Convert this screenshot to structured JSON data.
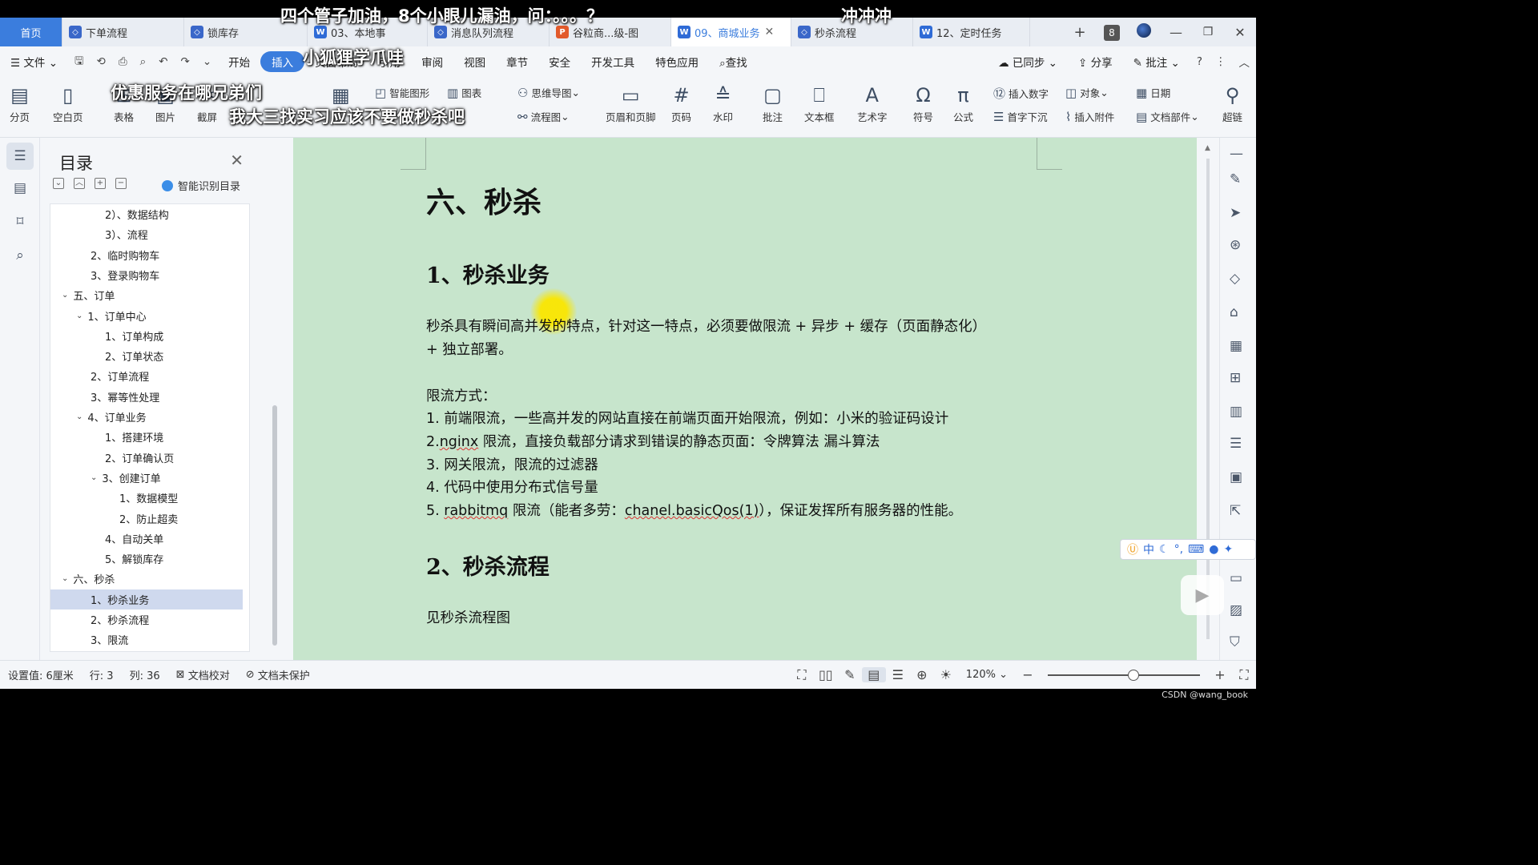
{
  "tabs": [
    {
      "label": "首页",
      "type": "home"
    },
    {
      "label": "下单流程",
      "icon": "diagram-icon"
    },
    {
      "label": "锁库存",
      "icon": "diagram-icon"
    },
    {
      "label": "03、本地事",
      "icon": "word-icon"
    },
    {
      "label": "消息队列流程",
      "icon": "diagram-icon"
    },
    {
      "label": "谷粒商...级-图",
      "icon": "ppt-icon"
    },
    {
      "label": "09、商城业务",
      "icon": "word-icon",
      "active": true
    },
    {
      "label": "秒杀流程",
      "icon": "diagram-icon"
    },
    {
      "label": "12、定时任务",
      "icon": "word-icon"
    }
  ],
  "tab_count_badge": "8",
  "menu": {
    "file": "文件",
    "items": [
      "开始",
      "插入",
      "页面布局",
      "引用",
      "审阅",
      "视图",
      "章节",
      "安全",
      "开发工具",
      "特色应用"
    ],
    "active": "插入",
    "search": "查找",
    "synced": "已同步",
    "share": "分享",
    "comment": "批注"
  },
  "ribbon": {
    "page_break": "分页",
    "blank_page": "空白页",
    "table": "表格",
    "picture": "图片",
    "screenshot": "截屏",
    "smart_shape": "智能图形",
    "chart": "图表",
    "mindmap": "思维导图",
    "flowchart": "流程图",
    "header_footer": "页眉和页脚",
    "page_number": "页码",
    "watermark": "水印",
    "comment": "批注",
    "textbox": "文本框",
    "wordart": "艺术字",
    "symbol": "符号",
    "formula": "公式",
    "insert_number": "插入数字",
    "drop_cap": "首字下沉",
    "object": "对象",
    "attachment": "插入附件",
    "date": "日期",
    "doc_parts": "文档部件",
    "hyperlink": "超链"
  },
  "toc": {
    "title": "目录",
    "smart": "智能识别目录",
    "items": [
      {
        "label": "2）、数据结构",
        "indent": 3
      },
      {
        "label": "3）、流程",
        "indent": 3
      },
      {
        "label": "2、临时购物车",
        "indent": 2
      },
      {
        "label": "3、登录购物车",
        "indent": 2
      },
      {
        "label": "五、订单",
        "indent": 0,
        "chev": true
      },
      {
        "label": "1、订单中心",
        "indent": 1,
        "chev": true
      },
      {
        "label": "1、订单构成",
        "indent": 3
      },
      {
        "label": "2、订单状态",
        "indent": 3
      },
      {
        "label": "2、订单流程",
        "indent": 2
      },
      {
        "label": "3、幂等性处理",
        "indent": 2
      },
      {
        "label": "4、订单业务",
        "indent": 1,
        "chev": true
      },
      {
        "label": "1、搭建环境",
        "indent": 3
      },
      {
        "label": "2、订单确认页",
        "indent": 3
      },
      {
        "label": "3、创建订单",
        "indent": 2,
        "chev": true
      },
      {
        "label": "1、数据模型",
        "indent": 4
      },
      {
        "label": "2、防止超卖",
        "indent": 4
      },
      {
        "label": "4、自动关单",
        "indent": 3
      },
      {
        "label": "5、解锁库存",
        "indent": 3
      },
      {
        "label": "六、秒杀",
        "indent": 0,
        "chev": true
      },
      {
        "label": "1、秒杀业务",
        "indent": 2,
        "selected": true
      },
      {
        "label": "2、秒杀流程",
        "indent": 2
      },
      {
        "label": "3、限流",
        "indent": 2
      }
    ]
  },
  "doc": {
    "h1": "六、秒杀",
    "h2a": "1、秒杀业务",
    "para1a": "秒杀具有瞬间高并发的特点，针对这一特点，必须要做限流 + 异步 + 缓存（页面静态化）",
    "para1b": "+ 独立部署。",
    "para2": "限流方式：",
    "li1": "1. 前端限流，一些高并发的网站直接在前端页面开始限流，例如：小米的验证码设计",
    "li2a": "2.",
    "li2b": "nginx",
    "li2c": " 限流，直接负载部分请求到错误的静态页面：令牌算法 漏斗算法",
    "li3": "3. 网关限流，限流的过滤器",
    "li4": "4. 代码中使用分布式信号量",
    "li5a": "5.  ",
    "li5b": "rabbitmq",
    "li5c": " 限流（能者多劳：",
    "li5d": "chanel.basicQos(1)",
    "li5e": "），保证发挥所有服务器的性能。",
    "h2b": "2、秒杀流程",
    "para3": "见秒杀流程图"
  },
  "status": {
    "setting": "设置值: 6厘米",
    "row": "行: 3",
    "col": "列: 36",
    "proof": "文档校对",
    "protect": "文档未保护",
    "zoom": "120%"
  },
  "ime": {
    "lang": "中"
  },
  "danmaku": {
    "d1": "四个管子加油，8个小眼儿漏油，问：。。。？",
    "d2": "冲冲冲",
    "d3": "小狐狸学爪哇",
    "d4": "优惠服务在哪兄弟们",
    "d5": "我大三找实习应该不要做秒杀吧"
  },
  "watermark": "CSDN @wang_book"
}
